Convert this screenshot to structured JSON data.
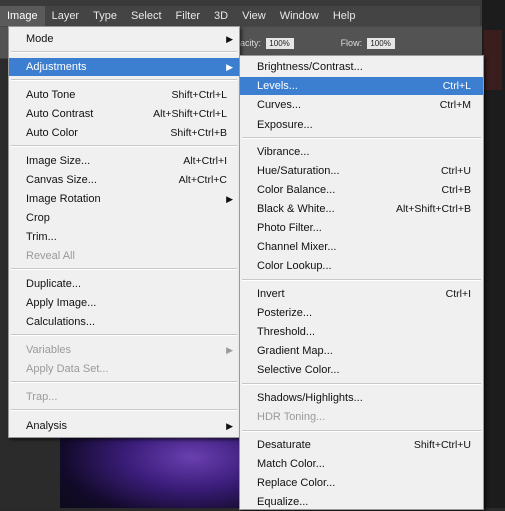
{
  "menubar": {
    "items": [
      "Image",
      "Layer",
      "Type",
      "Select",
      "Filter",
      "3D",
      "View",
      "Window",
      "Help"
    ]
  },
  "options": {
    "opacity_label": "acity:",
    "opacity_value": "100%",
    "flow_label": "Flow:",
    "flow_value": "100%"
  },
  "image_menu": {
    "items": [
      {
        "label": "Mode",
        "shortcut": "",
        "submenu": true,
        "disabled": false,
        "highlight": false
      },
      {
        "label": "Adjustments",
        "shortcut": "",
        "submenu": true,
        "disabled": false,
        "highlight": true
      },
      {
        "label": "Auto Tone",
        "shortcut": "Shift+Ctrl+L",
        "submenu": false,
        "disabled": false
      },
      {
        "label": "Auto Contrast",
        "shortcut": "Alt+Shift+Ctrl+L",
        "submenu": false,
        "disabled": false
      },
      {
        "label": "Auto Color",
        "shortcut": "Shift+Ctrl+B",
        "submenu": false,
        "disabled": false
      },
      {
        "label": "Image Size...",
        "shortcut": "Alt+Ctrl+I",
        "submenu": false,
        "disabled": false
      },
      {
        "label": "Canvas Size...",
        "shortcut": "Alt+Ctrl+C",
        "submenu": false,
        "disabled": false
      },
      {
        "label": "Image Rotation",
        "shortcut": "",
        "submenu": true,
        "disabled": false
      },
      {
        "label": "Crop",
        "shortcut": "",
        "submenu": false,
        "disabled": false
      },
      {
        "label": "Trim...",
        "shortcut": "",
        "submenu": false,
        "disabled": false
      },
      {
        "label": "Reveal All",
        "shortcut": "",
        "submenu": false,
        "disabled": true
      },
      {
        "label": "Duplicate...",
        "shortcut": "",
        "submenu": false,
        "disabled": false
      },
      {
        "label": "Apply Image...",
        "shortcut": "",
        "submenu": false,
        "disabled": false
      },
      {
        "label": "Calculations...",
        "shortcut": "",
        "submenu": false,
        "disabled": false
      },
      {
        "label": "Variables",
        "shortcut": "",
        "submenu": true,
        "disabled": true
      },
      {
        "label": "Apply Data Set...",
        "shortcut": "",
        "submenu": false,
        "disabled": true
      },
      {
        "label": "Trap...",
        "shortcut": "",
        "submenu": false,
        "disabled": true
      },
      {
        "label": "Analysis",
        "shortcut": "",
        "submenu": true,
        "disabled": false
      }
    ]
  },
  "adjustments_menu": {
    "items": [
      {
        "label": "Brightness/Contrast...",
        "shortcut": "",
        "disabled": false,
        "highlight": false
      },
      {
        "label": "Levels...",
        "shortcut": "Ctrl+L",
        "disabled": false,
        "highlight": true
      },
      {
        "label": "Curves...",
        "shortcut": "Ctrl+M",
        "disabled": false
      },
      {
        "label": "Exposure...",
        "shortcut": "",
        "disabled": false
      },
      {
        "label": "Vibrance...",
        "shortcut": "",
        "disabled": false
      },
      {
        "label": "Hue/Saturation...",
        "shortcut": "Ctrl+U",
        "disabled": false
      },
      {
        "label": "Color Balance...",
        "shortcut": "Ctrl+B",
        "disabled": false
      },
      {
        "label": "Black & White...",
        "shortcut": "Alt+Shift+Ctrl+B",
        "disabled": false
      },
      {
        "label": "Photo Filter...",
        "shortcut": "",
        "disabled": false
      },
      {
        "label": "Channel Mixer...",
        "shortcut": "",
        "disabled": false
      },
      {
        "label": "Color Lookup...",
        "shortcut": "",
        "disabled": false
      },
      {
        "label": "Invert",
        "shortcut": "Ctrl+I",
        "disabled": false
      },
      {
        "label": "Posterize...",
        "shortcut": "",
        "disabled": false
      },
      {
        "label": "Threshold...",
        "shortcut": "",
        "disabled": false
      },
      {
        "label": "Gradient Map...",
        "shortcut": "",
        "disabled": false
      },
      {
        "label": "Selective Color...",
        "shortcut": "",
        "disabled": false
      },
      {
        "label": "Shadows/Highlights...",
        "shortcut": "",
        "disabled": false
      },
      {
        "label": "HDR Toning...",
        "shortcut": "",
        "disabled": true
      },
      {
        "label": "Desaturate",
        "shortcut": "Shift+Ctrl+U",
        "disabled": false
      },
      {
        "label": "Match Color...",
        "shortcut": "",
        "disabled": false
      },
      {
        "label": "Replace Color...",
        "shortcut": "",
        "disabled": false
      },
      {
        "label": "Equalize...",
        "shortcut": "",
        "disabled": false
      }
    ]
  },
  "colors": {
    "highlight": "#3c7fd0",
    "menu_bg": "#f0f0f0",
    "disabled_text": "#9a9a9a"
  }
}
